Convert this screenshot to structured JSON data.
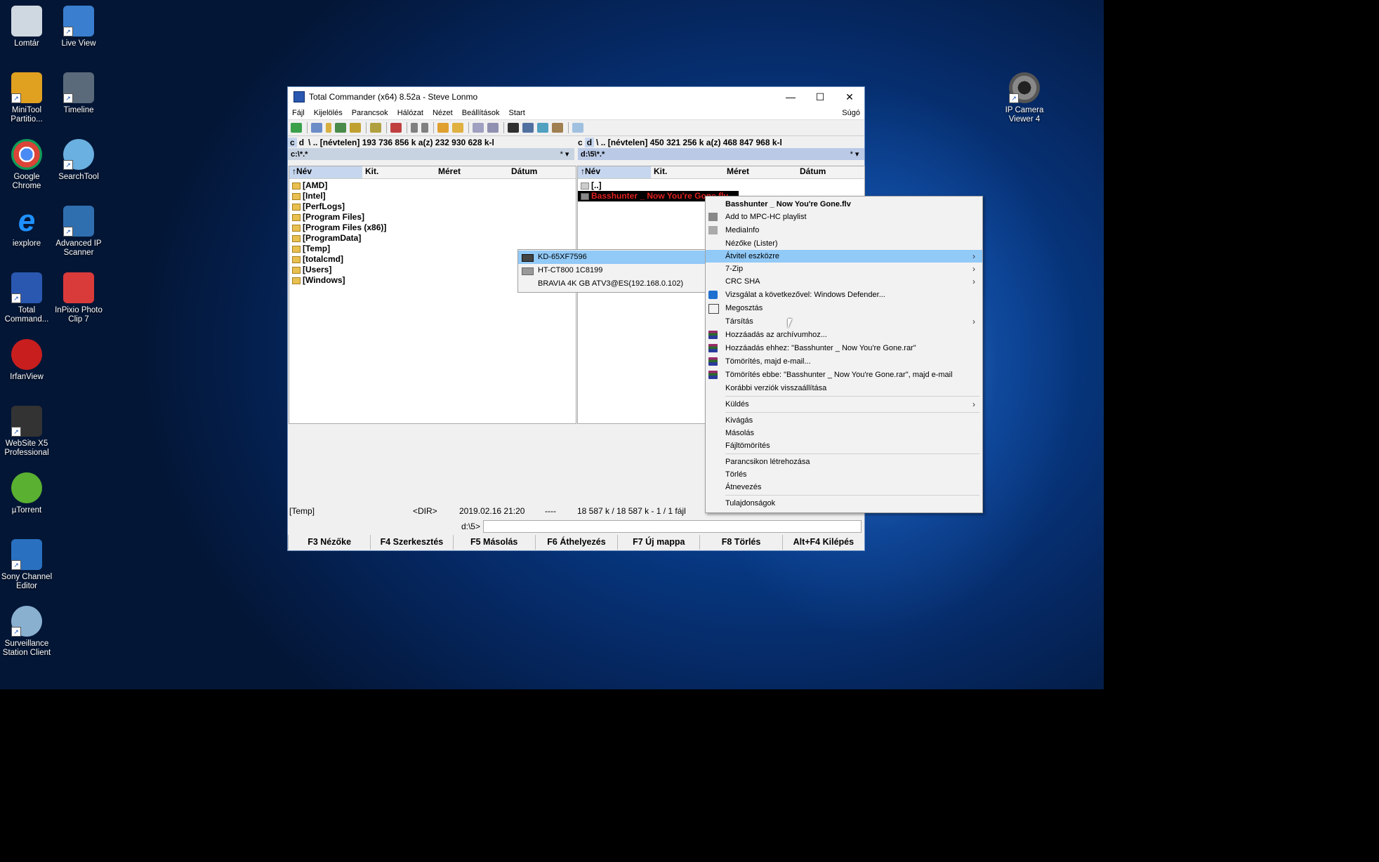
{
  "desktop": {
    "left_icons": [
      {
        "label": "Lomtár",
        "icon": "recycle-bin-icon",
        "color": "#cfd8e0"
      },
      {
        "label": "Live View",
        "icon": "monitor-icon",
        "color": "#3a7fcf"
      },
      {
        "label": "MiniTool Partitio...",
        "icon": "minitool-icon",
        "color": "#e0a020"
      },
      {
        "label": "Timeline",
        "icon": "timeline-icon",
        "color": "#5a6a7a"
      },
      {
        "label": "Google Chrome",
        "icon": "chrome-icon",
        "color": "#db4437"
      },
      {
        "label": "SearchTool",
        "icon": "search-tool-icon",
        "color": "#6ab0e0"
      },
      {
        "label": "iexplore",
        "icon": "internet-explorer-icon",
        "color": "#1e90ff"
      },
      {
        "label": "Advanced IP Scanner",
        "icon": "network-scanner-icon",
        "color": "#2f6fb0"
      },
      {
        "label": "Total Command...",
        "icon": "floppy-icon",
        "color": "#2a58b0"
      },
      {
        "label": "InPixio Photo Clip 7",
        "icon": "inpixio-icon",
        "color": "#d93a3a"
      },
      {
        "label": "IrfanView",
        "icon": "irfanview-icon",
        "color": "#c81e1e"
      },
      {
        "label": "WebSite X5 Professional",
        "icon": "website-x5-icon",
        "color": "#333333"
      },
      {
        "label": "µTorrent",
        "icon": "utorrent-icon",
        "color": "#5ab030"
      },
      {
        "label": "Sony Channel Editor",
        "icon": "channel-editor-icon",
        "color": "#2a70c0"
      },
      {
        "label": "Surveillance Station Client",
        "icon": "surveillance-icon",
        "color": "#8ab0d0"
      }
    ],
    "right_icons": [
      {
        "label": "IP Camera Viewer 4",
        "icon": "camera-lens-icon",
        "color": "#555555"
      }
    ]
  },
  "window": {
    "title": "Total Commander (x64) 8.52a - Steve Lonmo",
    "controls": {
      "minimize": "—",
      "maximize": "☐",
      "close": "✕"
    },
    "menu": [
      "Fájl",
      "Kijelölés",
      "Parancsok",
      "Hálózat",
      "Nézet",
      "Beállítások",
      "Start"
    ],
    "help": "Súgó",
    "left_drivebar": "c   d   \\   ..  [névtelen]  193 736 856 k a(z) 232 930 628 k-l",
    "left_drives": [
      "c",
      "d"
    ],
    "left_drive_info": "\\  ..  [névtelen]  193 736 856 k a(z) 232 930 628 k-l",
    "right_drives": [
      "c",
      "d"
    ],
    "right_drive_info": "\\  ..  [névtelen]  450 321 256 k a(z) 468 847 968 k-l",
    "left_path": "c:\\*.*",
    "right_path": "d:\\5\\*.*",
    "hist": "* ▾",
    "columns": {
      "name": "↑Név",
      "ext": "Kit.",
      "size": "Méret",
      "date": "Dátum"
    },
    "left_files": [
      "[AMD]",
      "[Intel]",
      "[PerfLogs]",
      "[Program Files]",
      "[Program Files (x86)]",
      "[ProgramData]",
      "[Temp]",
      "[totalcmd]",
      "[Users]",
      "[Windows]"
    ],
    "right_files": [
      "[..]",
      "Basshunter _ Now You're Gone.flv"
    ],
    "status_left": "[Temp]",
    "status_dir": "<DIR>",
    "status_date": "2019.02.16 21:20",
    "status_attr": "----",
    "status_right": "18 587 k / 18 587 k - 1 / 1 fájl",
    "cmd_label": "d:\\5>",
    "fkeys": [
      "F3 Nézőke",
      "F4 Szerkesztés",
      "F5 Másolás",
      "F6 Áthelyezés",
      "F7 Új mappa",
      "F8 Törlés",
      "Alt+F4 Kilépés"
    ]
  },
  "context_menu": {
    "header": "Basshunter _ Now You're Gone.flv",
    "items": [
      {
        "label": "Add to MPC-HC playlist",
        "icon": "mpc-icon"
      },
      {
        "label": "MediaInfo",
        "icon": "mediainfo-icon"
      },
      {
        "label": "Nézőke (Lister)"
      },
      {
        "label": "Átvitel eszközre",
        "submenu": "›",
        "highlighted": true
      },
      {
        "label": "7-Zip",
        "submenu": "›"
      },
      {
        "label": "CRC SHA",
        "submenu": "›"
      },
      {
        "label": "Vizsgálat a következővel: Windows Defender...",
        "icon": "defender-icon"
      },
      {
        "label": "Megosztás",
        "icon": "share-icon"
      },
      {
        "label": "Társítás",
        "submenu": "›"
      },
      {
        "label": "Hozzáadás az archívumhoz...",
        "icon": "winrar-icon"
      },
      {
        "label": "Hozzáadás ehhez: \"Basshunter _ Now You're Gone.rar\"",
        "icon": "winrar-icon"
      },
      {
        "label": "Tömörítés, majd e-mail...",
        "icon": "winrar-icon"
      },
      {
        "label": "Tömörítés ebbe: \"Basshunter _ Now You're Gone.rar\", majd e-mail",
        "icon": "winrar-icon"
      },
      {
        "label": "Korábbi verziók visszaállítása"
      },
      {
        "label": "Küldés",
        "submenu": "›"
      },
      {
        "label": "Kivágás"
      },
      {
        "label": "Másolás"
      },
      {
        "label": "Fájltömörítés"
      },
      {
        "label": "Parancsikon létrehozása"
      },
      {
        "label": "Törlés"
      },
      {
        "label": "Átnevezés"
      },
      {
        "label": "Tulajdonságok"
      }
    ]
  },
  "submenu": {
    "items": [
      {
        "label": "KD-65XF7596",
        "highlighted": true
      },
      {
        "label": "HT-CT800 1C8199"
      },
      {
        "label": "BRAVIA 4K GB ATV3@ES(192.168.0.102)"
      }
    ]
  },
  "colors": {
    "highlight": "#91c9f7",
    "selected_file": "#e02020",
    "title_icon": "#2a58b0"
  }
}
